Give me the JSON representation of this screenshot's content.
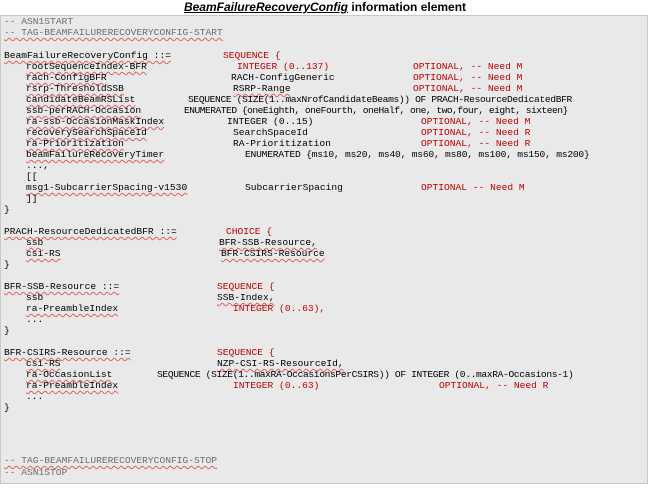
{
  "title": {
    "ie_name": "BeamFailureRecoveryConfig",
    "suffix": "information element"
  },
  "code": {
    "l1": {
      "a": "-- ASN1START"
    },
    "l2": {
      "a": "-- TAG-BEAMFAILURERECOVERYCONFIG-START"
    },
    "l4": {
      "a": "BeamFailureRecoveryConfig ::=",
      "b": "SEQUENCE {"
    },
    "l5": {
      "a": "rootSequenceIndex-BFR",
      "b": "INTEGER (0..137)",
      "c": "OPTIONAL, -- Need M"
    },
    "l6": {
      "a": "rach-ConfigBFR",
      "b": "RACH-ConfigGeneric",
      "c": "OPTIONAL, -- Need M"
    },
    "l7": {
      "a": "rsrp-ThresholdSSB",
      "b": "RSRP-Range",
      "c": "OPTIONAL, -- Need M"
    },
    "l8": {
      "a": "candidateBeamRSList",
      "b": "SEQUENCE (SIZE(1..maxNrofCandidateBeams)) OF PRACH-ResourceDedicatedBFR"
    },
    "l9": {
      "a": "ssb-perRACH-Occasion",
      "b": "ENUMERATED {oneEighth, oneFourth, oneHalf, one, two,four, eight, sixteen}"
    },
    "l10": {
      "a": "ra-ssb-OccasionMaskIndex",
      "b": "INTEGER (0..15)",
      "c": "OPTIONAL, -- Need M"
    },
    "l11": {
      "a": "recoverySearchSpaceId",
      "b": "SearchSpaceId",
      "c": "OPTIONAL, -- Need R"
    },
    "l12": {
      "a": "ra-Prioritization",
      "b": "RA-Prioritization",
      "c": "OPTIONAL, -- Need R"
    },
    "l13": {
      "a": "beamFailureRecoveryTimer",
      "b": "ENUMERATED {ms10, ms20, ms40, ms60, ms80, ms100, ms150, ms200}"
    },
    "l14": {
      "a": "...,"
    },
    "l15": {
      "a": "[["
    },
    "l16": {
      "a": "msg1-SubcarrierSpacing-v1530",
      "b": "SubcarrierSpacing",
      "c": "OPTIONAL -- Need M"
    },
    "l17": {
      "a": "]]"
    },
    "l18": {
      "a": "}"
    },
    "l20": {
      "a": "PRACH-ResourceDedicatedBFR ::=",
      "b": "CHOICE {"
    },
    "l21": {
      "a": "ssb",
      "b": "BFR-SSB-Resource,"
    },
    "l22": {
      "a": "csi-RS",
      "b": "BFR-CSIRS-Resource"
    },
    "l23": {
      "a": "}"
    },
    "l25": {
      "a": "BFR-SSB-Resource ::=",
      "b": "SEQUENCE {"
    },
    "l26": {
      "a": "ssb",
      "b": "SSB-Index,"
    },
    "l27": {
      "a": "ra-PreambleIndex",
      "b": "INTEGER (0..63),"
    },
    "l28": {
      "a": "..."
    },
    "l29": {
      "a": "}"
    },
    "l31": {
      "a": "BFR-CSIRS-Resource ::=",
      "b": "SEQUENCE {"
    },
    "l32": {
      "a": "csi-RS",
      "b": "NZP-CSI-RS-ResourceId,"
    },
    "l33": {
      "a": "ra-OccasionList",
      "b": "SEQUENCE (SIZE(1..maxRA-OccasionsPerCSIRS)) OF INTEGER (0..maxRA-Occasions-1)"
    },
    "l34": {
      "a": "ra-PreambleIndex",
      "b": "INTEGER (0..63)",
      "c": "OPTIONAL, -- Need R"
    },
    "l35": {
      "a": "..."
    },
    "l36": {
      "a": "}"
    },
    "l38": {
      "a": "-- TAG-BEAMFAILURERECOVERYCONFIG-STOP"
    },
    "l39": {
      "a": "-- ASN1STOP"
    }
  }
}
